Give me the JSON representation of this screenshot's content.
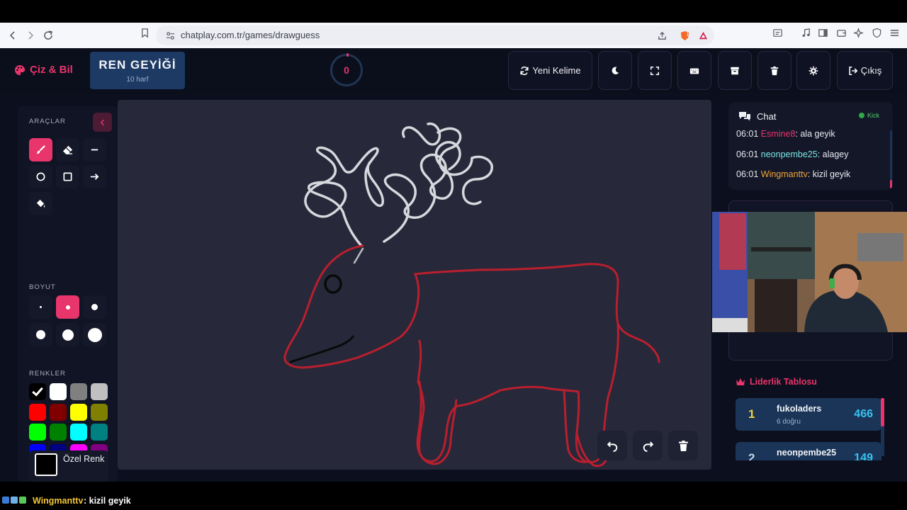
{
  "browser": {
    "url": "chatplay.com.tr/games/drawguess",
    "icons": [
      "back-icon",
      "forward-icon",
      "reload-icon",
      "bookmark-icon",
      "site-settings-icon",
      "share-icon",
      "brave-shield-icon",
      "brave-rewards-icon",
      "reader-mode-icon",
      "music-icon",
      "sidebar-icon",
      "wallet-icon",
      "leo-ai-icon",
      "vpn-icon",
      "menu-icon"
    ],
    "shield_badge": "1"
  },
  "app": {
    "logo": "Çiz & Bil",
    "word": {
      "title": "REN GEYİĞİ",
      "hint": "10 harf"
    },
    "timer": "0",
    "header_buttons": [
      {
        "label": "Yeni Kelime",
        "icon": "refresh-icon"
      },
      {
        "label": "",
        "icon": "moon-icon"
      },
      {
        "label": "",
        "icon": "fullscreen-icon"
      },
      {
        "label": "",
        "icon": "keyboard-icon"
      },
      {
        "label": "",
        "icon": "archive-icon"
      },
      {
        "label": "",
        "icon": "trash-icon"
      },
      {
        "label": "",
        "icon": "gear-icon"
      },
      {
        "label": "Çıkış",
        "icon": "logout-icon"
      }
    ]
  },
  "tools": {
    "label_tools": "ARAÇLAR",
    "label_size": "BOYUT",
    "label_colors": "RENKLER",
    "tool_list": [
      "brush",
      "eraser",
      "line",
      "circle",
      "rectangle",
      "arrow",
      "fill"
    ],
    "active_tool": "brush",
    "sizes": [
      2,
      4,
      6,
      8,
      10,
      13
    ],
    "active_size_index": 1,
    "colors": [
      "#000000",
      "#ffffff",
      "#808080",
      "#c0c0c0",
      "#ff0000",
      "#800000",
      "#ffff00",
      "#808000",
      "#00ff00",
      "#008000",
      "#00ffff",
      "#008080",
      "#0000ff",
      "#000080",
      "#ff00ff",
      "#800080",
      "#ffa500",
      "#a52a2a",
      "#ffc0cb",
      "#ffd700"
    ],
    "selected_color": "#000000",
    "custom_color_label": "Özel Renk"
  },
  "canvas": {
    "background": "#272839",
    "buttons": [
      "undo-icon",
      "redo-icon",
      "trash-icon"
    ]
  },
  "chat": {
    "title": "Chat",
    "platform": "Kick",
    "messages": [
      {
        "time": "06:01",
        "user": "Esmine8",
        "color": "#e8356b",
        "text": ": ala geyik"
      },
      {
        "time": "06:01",
        "user": "neonpembe25",
        "color": "#7ce3e3",
        "text": ": alagey"
      },
      {
        "time": "06:01",
        "user": "Wingmanttv",
        "color": "#f2a33a",
        "text": ": kizil geyik"
      }
    ]
  },
  "leaderboard": {
    "title": "Liderlik Tablosu",
    "rows": [
      {
        "rank": "1",
        "name": "fukoladers",
        "sub": "6 doğru",
        "score": "466"
      },
      {
        "rank": "2",
        "name": "neonpembe25",
        "sub": "",
        "score": "149"
      }
    ]
  },
  "ticker": {
    "user": "Wingmanttv",
    "message": ": kizil geyik"
  }
}
